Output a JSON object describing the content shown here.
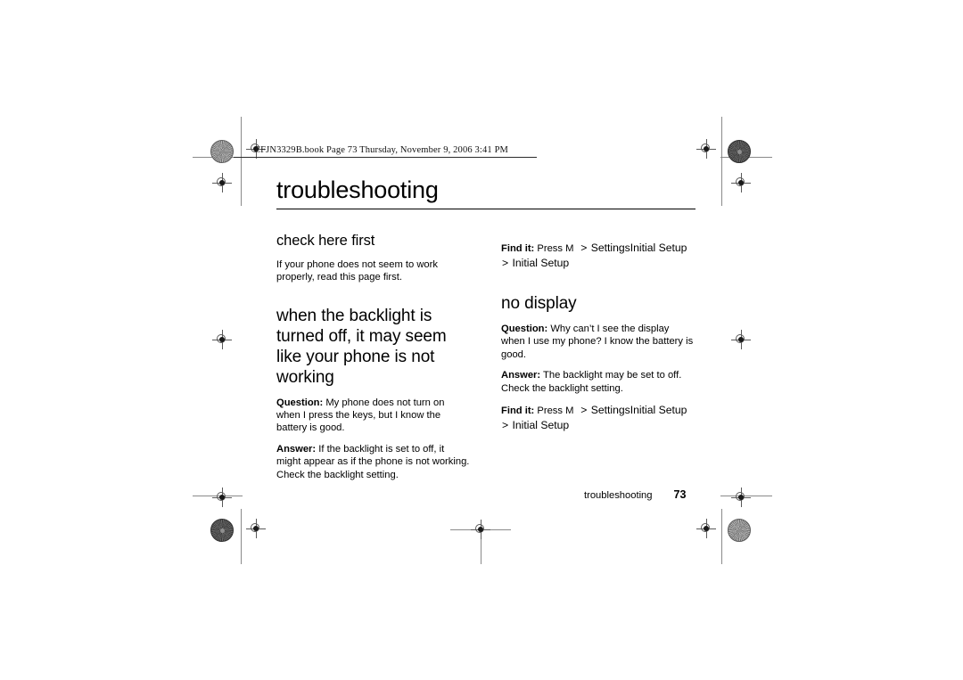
{
  "document": {
    "file_stamp": "CFJN3329B.book  Page 73  Thursday, November 9, 2006  3:41 PM",
    "chapter_title": "troubleshooting",
    "footer_label": "troubleshooting",
    "page_number": "73"
  },
  "left_column": {
    "section1": {
      "heading": "check here first",
      "paragraph": "If your phone does not seem to work properly, read this page first."
    },
    "section2": {
      "heading": "when the backlight is turned off, it may seem like your phone is not working",
      "question_label": "Question:",
      "question_text": " My phone does not turn on when I press the keys, but I know the battery is good.",
      "answer_label": "Answer:",
      "answer_text": " If the backlight is set to off, it might appear as if the phone is not working. Check the backlight setting."
    }
  },
  "right_column": {
    "find_it_top": {
      "label": "Find it:",
      "press_text": " Press M",
      "arrow1": ">",
      "path1": "SettingsInitial Setup",
      "arrow2": ">",
      "path2": "Initial Setup"
    },
    "section": {
      "heading": "no display",
      "question_label": "Question:",
      "question_text": " Why can’t I see the display when I use my phone? I know the battery is good.",
      "answer_label": "Answer:",
      "answer_text": " The backlight may be set to off. Check the backlight setting."
    },
    "find_it_bottom": {
      "label": "Find it:",
      "press_text": " Press M",
      "arrow1": ">",
      "path1": "SettingsInitial Setup",
      "arrow2": ">",
      "path2": "Initial Setup"
    }
  },
  "print_marks": {
    "description": "printer registration targets and trim lines"
  }
}
